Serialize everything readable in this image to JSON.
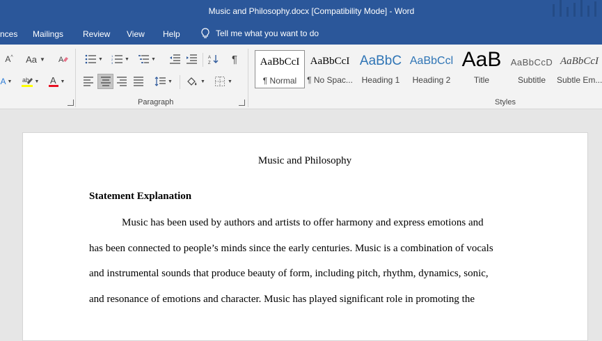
{
  "window": {
    "title": "Music and Philosophy.docx [Compatibility Mode]  -  Word"
  },
  "ribbon_tabs": [
    "nces",
    "Mailings",
    "Review",
    "View",
    "Help"
  ],
  "tell_me": "Tell me what you want to do",
  "paragraph_group": {
    "label": "Paragraph"
  },
  "font_group": {
    "case_label": "Aa"
  },
  "styles_group": {
    "label": "Styles",
    "items": [
      {
        "preview": "AaBbCcI",
        "name": "¶ Normal",
        "active": true
      },
      {
        "preview": "AaBbCcI",
        "name": "¶ No Spac...",
        "active": false
      },
      {
        "preview": "AaBbC",
        "name": "Heading 1",
        "active": false
      },
      {
        "preview": "AaBbCcl",
        "name": "Heading 2",
        "active": false
      },
      {
        "preview": "AaB",
        "name": "Title",
        "active": false
      },
      {
        "preview": "AaBbCcD",
        "name": "Subtitle",
        "active": false
      },
      {
        "preview": "AaBbCcI",
        "name": "Subtle Em...",
        "active": false
      }
    ]
  },
  "document": {
    "title": "Music and Philosophy",
    "heading": "Statement Explanation",
    "lines": [
      "Music has been used by authors and artists to offer harmony and express emotions and",
      "has been connected to people’s minds since the early centuries. Music is a combination of vocals",
      "and instrumental sounds that produce beauty of form, including pitch, rhythm, dynamics, sonic,",
      "and resonance of emotions and character. Music has played significant role in promoting the"
    ]
  },
  "colors": {
    "title_bar": "#2b579a",
    "highlight": "#ffff00",
    "font_color": "#e81123"
  }
}
